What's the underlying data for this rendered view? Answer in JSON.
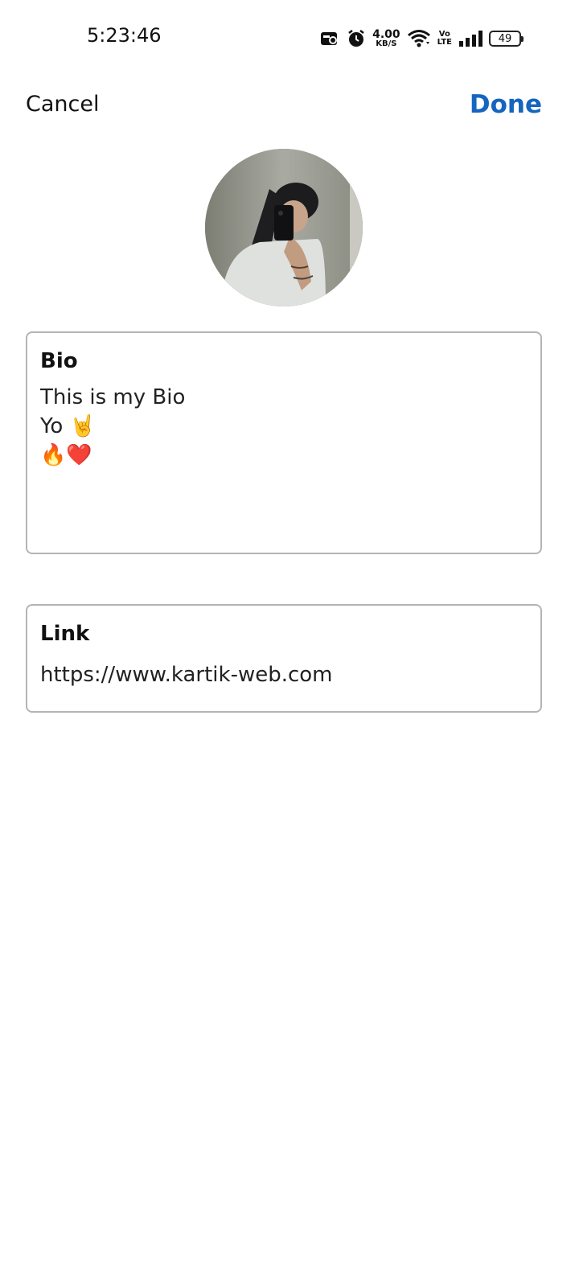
{
  "status_bar": {
    "time": "5:23:46",
    "net_speed_value": "4.00",
    "net_speed_unit": "KB/S",
    "volte_top": "Vo",
    "volte_bottom": "LTE",
    "battery_level": "49",
    "icons": [
      "screen-record-icon",
      "alarm-icon",
      "wifi-icon",
      "volte-icon",
      "signal-icon",
      "battery-icon"
    ]
  },
  "header": {
    "cancel_label": "Cancel",
    "done_label": "Done",
    "done_color": "#1565c0"
  },
  "bio": {
    "label": "Bio",
    "value": "This is my Bio\nYo 🤘\n🔥❤️"
  },
  "link": {
    "label": "Link",
    "value": "https://www.kartik-web.com"
  }
}
